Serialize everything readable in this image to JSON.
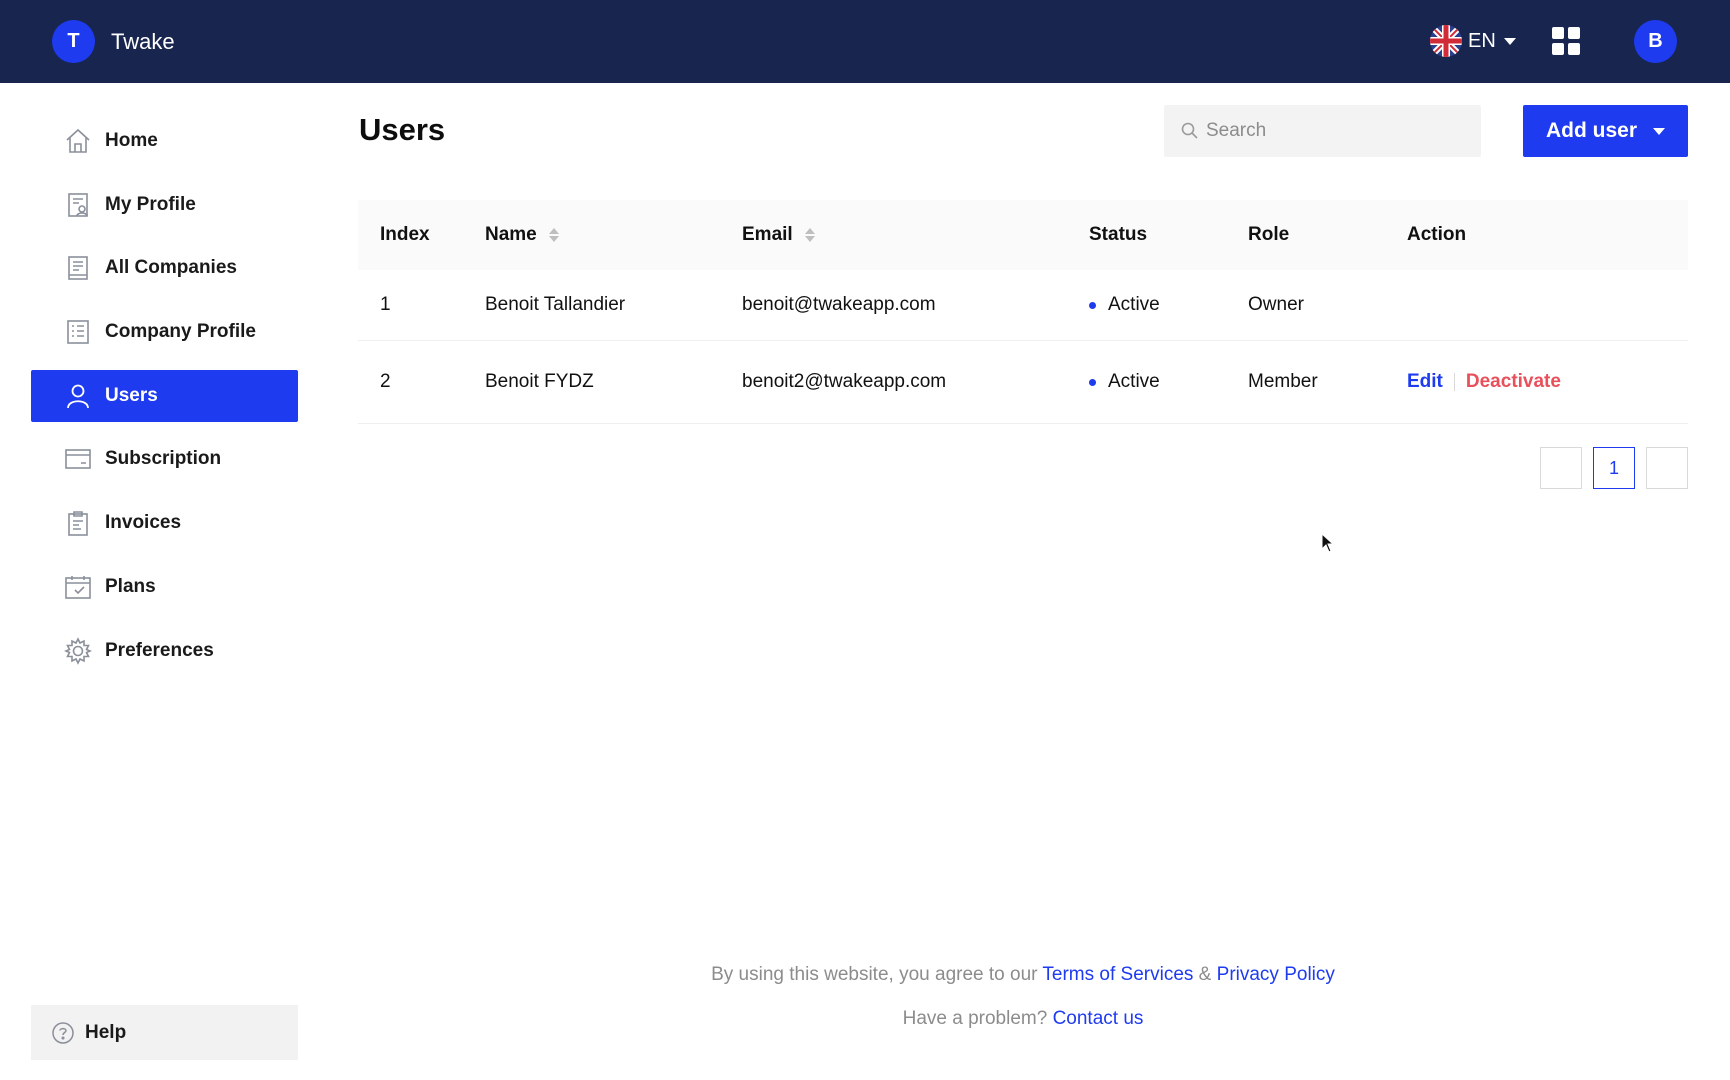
{
  "header": {
    "brand_initial": "T",
    "brand_name": "Twake",
    "language_code": "EN",
    "user_initial": "B"
  },
  "sidebar": {
    "items": [
      {
        "label": "Home",
        "icon": "home-icon"
      },
      {
        "label": "My Profile",
        "icon": "profile-icon"
      },
      {
        "label": "All Companies",
        "icon": "companies-icon"
      },
      {
        "label": "Company Profile",
        "icon": "company-profile-icon"
      },
      {
        "label": "Users",
        "icon": "user-icon",
        "active": true
      },
      {
        "label": "Subscription",
        "icon": "card-icon"
      },
      {
        "label": "Invoices",
        "icon": "invoice-icon"
      },
      {
        "label": "Plans",
        "icon": "calendar-check-icon"
      },
      {
        "label": "Preferences",
        "icon": "gear-icon"
      }
    ],
    "help_label": "Help"
  },
  "main": {
    "title": "Users",
    "search_placeholder": "Search",
    "add_user_label": "Add user",
    "columns": [
      "Index",
      "Name",
      "Email",
      "Status",
      "Role",
      "Action"
    ],
    "rows": [
      {
        "index": "1",
        "name": "Benoit Tallandier",
        "email": "benoit@twakeapp.com",
        "status": "Active",
        "role": "Owner"
      },
      {
        "index": "2",
        "name": "Benoit FYDZ",
        "email": "benoit2@twakeapp.com",
        "status": "Active",
        "role": "Member",
        "edit_label": "Edit",
        "deactivate_label": "Deactivate"
      }
    ],
    "pagination": {
      "current_page": "1"
    }
  },
  "footer": {
    "agree_text": "By using this website, you agree to our",
    "terms_label": "Terms of Services",
    "amp": "&",
    "privacy_label": "Privacy Policy",
    "problem_text": "Have a problem?",
    "contact_label": "Contact us"
  },
  "colors": {
    "header_bg": "#17254f",
    "accent": "#1e3bf0",
    "danger": "#e8505b"
  }
}
